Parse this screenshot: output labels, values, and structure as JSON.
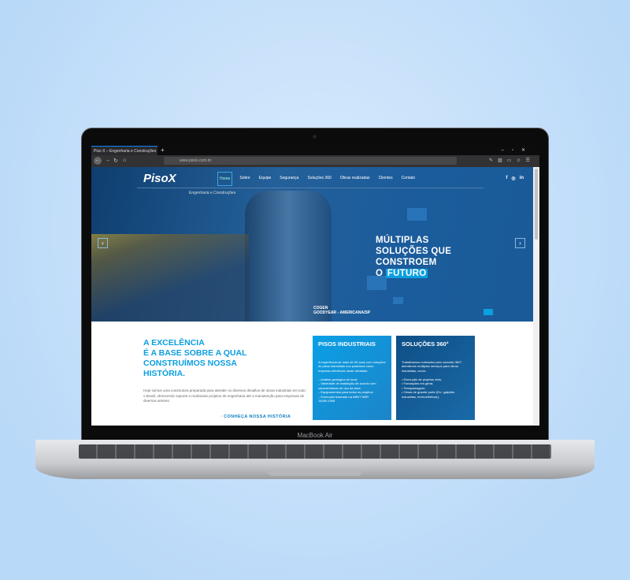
{
  "browser": {
    "tab_title": "Piso X – Engenharia e Construções",
    "url": "www.pisox.com.br",
    "new_tab": "+"
  },
  "site": {
    "logo": "PisoX",
    "tagline": "Engenharia e Construções",
    "nav": [
      "Home",
      "Sobre",
      "Equipe",
      "Segurança",
      "Soluções 360",
      "Obras realizadas",
      "Clientes",
      "Contato"
    ],
    "social": [
      "f",
      "◎",
      "in"
    ],
    "hero": {
      "line1": "MÚLTIPLAS",
      "line2": "SOLUÇÕES QUE",
      "line3": "CONSTROEM",
      "line4a": "O",
      "line4b": "FUTURO",
      "caption_title": "COGEN",
      "caption_sub": "GOODYEAR - AMERICANA/SP",
      "prev": "‹",
      "next": "›"
    },
    "about": {
      "headline": [
        "A EXCELÊNCIA",
        "É A BASE SOBRE A QUAL",
        "CONSTRUÍMOS NOSSA",
        "HISTÓRIA."
      ],
      "body": "Hoje somos uma construtora preparada para atender os diversos desafios de obras industriais em todo o Brasil, oferecendo suporte e realizando projetos de engenharia até a manutenção para empresas de diversos setores.",
      "link": "CONHEÇA NOSSA HISTÓRIA"
    },
    "cards": [
      {
        "title": "PISOS INDUSTRIAIS",
        "text": "A experiência de mais de 30 anos com soluções de pisos industriais nos posiciona como empresa referência neste atividade.",
        "items": [
          "– Análise geológica do local",
          "– Variedade de instalação de acordo com características de uso da área",
          "– Equipamentos para todos os projetos",
          "– Execução baseada na ABNT NBR 14050:1998"
        ]
      },
      {
        "title": "SOLUÇÕES 360°",
        "text": "Trabalhamos norteados pelo conceito 360°, atendendo múltiplos serviços para obras industriais, como:",
        "items": [
          "• Execução de projetos civis;",
          "• Fundações em geral;",
          "• Terraplanagem;",
          "• Obras de grande porte (Ex.: galpões industriais, termoelétricas);"
        ]
      }
    ]
  },
  "device": {
    "label": "MacBook Air"
  }
}
